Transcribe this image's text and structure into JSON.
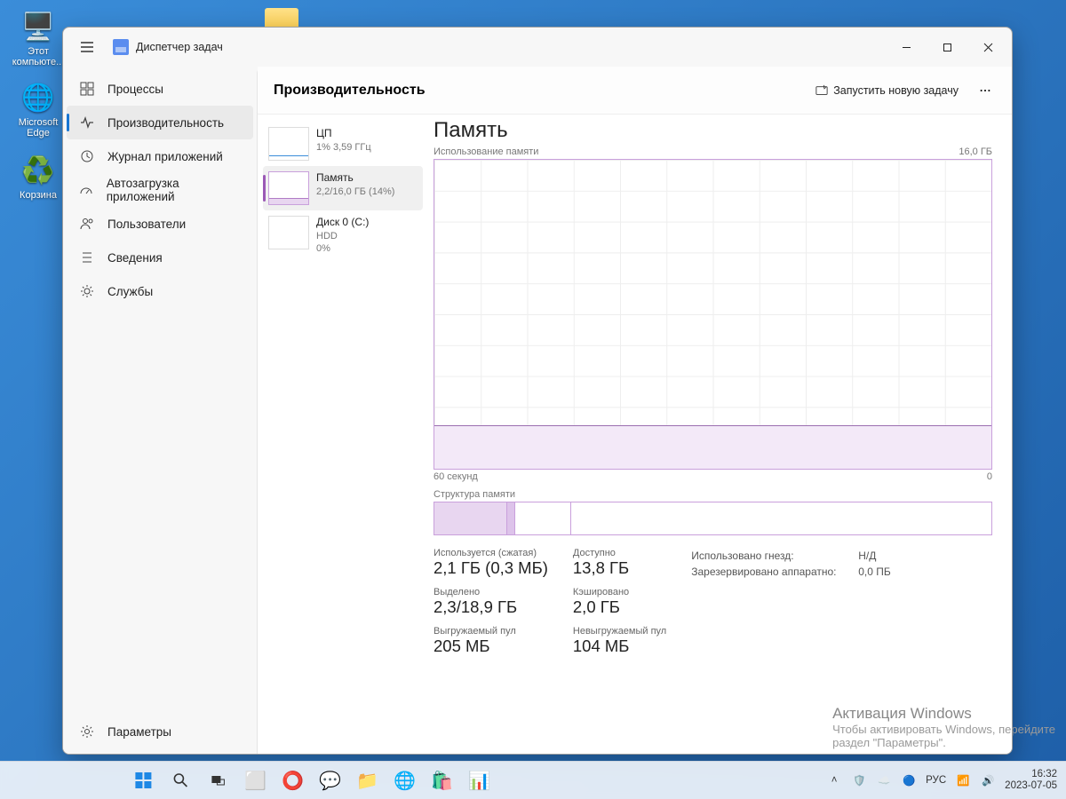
{
  "desktop": {
    "icons": [
      {
        "label": "Этот\nкомпьюте..."
      },
      {
        "label": "Microsoft\nEdge"
      },
      {
        "label": "Корзина"
      }
    ]
  },
  "window": {
    "title": "Диспетчер задач",
    "nav": [
      {
        "label": "Процессы"
      },
      {
        "label": "Производительность"
      },
      {
        "label": "Журнал приложений"
      },
      {
        "label": "Автозагрузка приложений"
      },
      {
        "label": "Пользователи"
      },
      {
        "label": "Сведения"
      },
      {
        "label": "Службы"
      }
    ],
    "settings_label": "Параметры",
    "content_title": "Производительность",
    "run_task": "Запустить новую задачу",
    "mini": [
      {
        "name": "ЦП",
        "sub": "1% 3,59 ГГц"
      },
      {
        "name": "Память",
        "sub": "2,2/16,0 ГБ (14%)"
      },
      {
        "name": "Диск 0 (C:)",
        "sub1": "HDD",
        "sub2": "0%"
      }
    ],
    "detail": {
      "title": "Память",
      "usage_label": "Использование памяти",
      "max_label": "16,0 ГБ",
      "axis_left": "60 секунд",
      "axis_right": "0",
      "comp_label": "Структура памяти",
      "stats": {
        "in_use_label": "Используется (сжатая)",
        "in_use": "2,1 ГБ (0,3 МБ)",
        "available_label": "Доступно",
        "available": "13,8 ГБ",
        "committed_label": "Выделено",
        "committed": "2,3/18,9 ГБ",
        "cached_label": "Кэшировано",
        "cached": "2,0 ГБ",
        "paged_label": "Выгружаемый пул",
        "paged": "205 МБ",
        "nonpaged_label": "Невыгружаемый пул",
        "nonpaged": "104 МБ"
      },
      "kv": {
        "slots_label": "Использовано гнезд:",
        "slots": "Н/Д",
        "hw_reserved_label": "Зарезервировано аппаратно:",
        "hw_reserved": "0,0 ПБ"
      }
    }
  },
  "watermark": {
    "title": "Активация Windows",
    "sub": "Чтобы активировать Windows, перейдите\nраздел \"Параметры\"."
  },
  "taskbar": {
    "lang": "РУС",
    "time": "16:32",
    "date": "2023-07-05"
  },
  "chart_data": {
    "type": "area",
    "title": "Память — Использование памяти",
    "xlabel": "60 секунд → 0",
    "ylabel": "ГБ",
    "ylim": [
      0,
      16
    ],
    "x": [
      60,
      55,
      50,
      45,
      40,
      35,
      30,
      25,
      20,
      15,
      10,
      5,
      0
    ],
    "values": [
      2.2,
      2.2,
      2.2,
      2.2,
      2.2,
      2.2,
      2.2,
      2.2,
      2.2,
      2.2,
      2.2,
      2.2,
      2.2
    ]
  }
}
